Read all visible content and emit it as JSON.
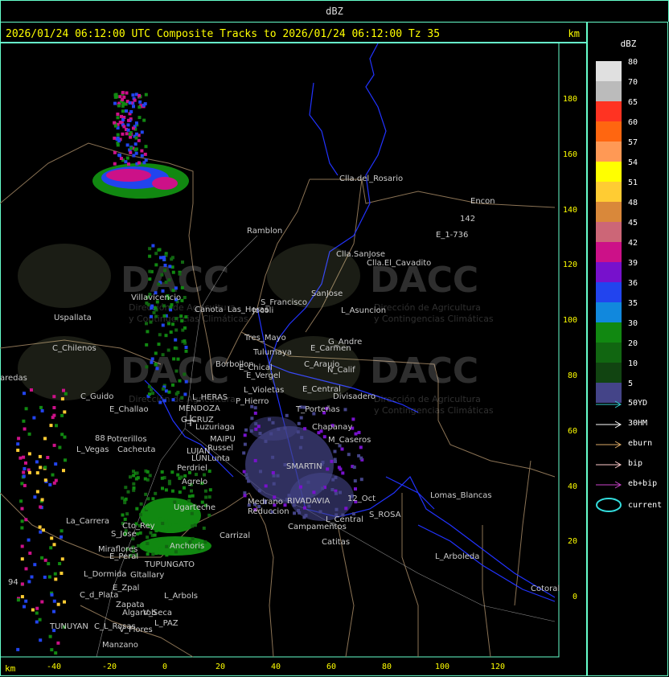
{
  "window_title": "dBZ",
  "header": {
    "text": "2026/01/24 06:12:00 UTC Composite Tracks to 2026/01/24 06:12:00 Tz 35",
    "unit_top": "km",
    "unit_bottom": "km"
  },
  "axes": {
    "x_ticks": [
      "-40",
      "-20",
      "0",
      "20",
      "40",
      "60",
      "80",
      "100",
      "120"
    ],
    "y_ticks": [
      "180",
      "160",
      "140",
      "120",
      "100",
      "80",
      "60",
      "40",
      "20",
      "0"
    ]
  },
  "legend": {
    "title": "dBZ",
    "levels": [
      {
        "label": "80",
        "color": "#e0e0e0"
      },
      {
        "label": "70",
        "color": "#bbbbbb"
      },
      {
        "label": "65",
        "color": "#ff3322"
      },
      {
        "label": "60",
        "color": "#ff6610"
      },
      {
        "label": "57",
        "color": "#ff9955"
      },
      {
        "label": "54",
        "color": "#ffff00"
      },
      {
        "label": "51",
        "color": "#ffcc33"
      },
      {
        "label": "48",
        "color": "#d9883a"
      },
      {
        "label": "45",
        "color": "#cc6677"
      },
      {
        "label": "42",
        "color": "#cc1188"
      },
      {
        "label": "39",
        "color": "#7711cc"
      },
      {
        "label": "36",
        "color": "#2244ee"
      },
      {
        "label": "35",
        "color": "#1188dd"
      },
      {
        "label": "30",
        "color": "#118811"
      },
      {
        "label": "20",
        "color": "#116611"
      },
      {
        "label": "10",
        "color": "#114411"
      },
      {
        "label": "5",
        "color": "#444488"
      }
    ],
    "tracks": [
      {
        "label": "50YD",
        "color": "#33cccc"
      },
      {
        "label": "30HM",
        "color": "#ffffff"
      },
      {
        "label": "eburn",
        "color": "#ddaa66"
      },
      {
        "label": "bip",
        "color": "#ffcccc"
      },
      {
        "label": "eb+bip",
        "color": "#cc44cc"
      }
    ],
    "current_label": "current",
    "current_color": "#33dddd"
  },
  "watermark": {
    "brand": "DACC",
    "line1": "Dirección de Agricultura",
    "line2": "y Contingencias Climáticas"
  },
  "places": [
    "Clla.del_Rosario",
    "Encon",
    "142",
    "E_1-736",
    "Ramblon",
    "Clla.SanJose",
    "Clla.El_Cavadito",
    "Villavicencio",
    "Uspallata",
    "Canota",
    "Las_Heras",
    "S_Francisco",
    "Jocoli",
    "SanJose",
    "L_Asuncion",
    "Tres_Mayo",
    "Tulumaya",
    "E_Carmen",
    "G_Andre",
    "C_Chilenos",
    "E_Chical",
    "E_Vergel",
    "C_Araujo",
    "N_Calif",
    "aredas",
    "Borbollon",
    "L_Violetas",
    "E_Central",
    "Divisadero",
    "C_Guido",
    "E_Challao",
    "L_HERAS",
    "P_Hierro",
    "MENDOZA",
    "G_CRUZ",
    "Luzuriaga",
    "T_Porteñas",
    "Chapanay",
    "88",
    "Potrerillos",
    "MAIPU",
    "Russel",
    "L_Vegas",
    "Cacheuta",
    "LUJAN",
    "LUNLunta",
    "Perdriel",
    "M_Caseros",
    "SMARTIN",
    "Agrelo",
    "Medrano",
    "Reduccion",
    "RIVADAVIA",
    "12_Oct",
    "S_ROSA",
    "Lomas_Blancas",
    "Ugarteche",
    "Carrizal",
    "La_Carrera",
    "Cto_Rey",
    "S_Jose",
    "Anchoris",
    "Campamentos",
    "L_Central",
    "Catitas",
    "Miraflores",
    "E_Peral",
    "TUPUNGATO",
    "L_Arboleda",
    "L_Dormida",
    "Gltallary",
    "E_Zpal",
    "C_d_Plata",
    "L_Arbols",
    "Zapata",
    "Algarrob",
    "V_Seca",
    "Cotoral",
    "L_PAZ",
    "TUNUYAN",
    "Manzano",
    "V_Flores",
    "C_L_Rosas",
    "94"
  ]
}
